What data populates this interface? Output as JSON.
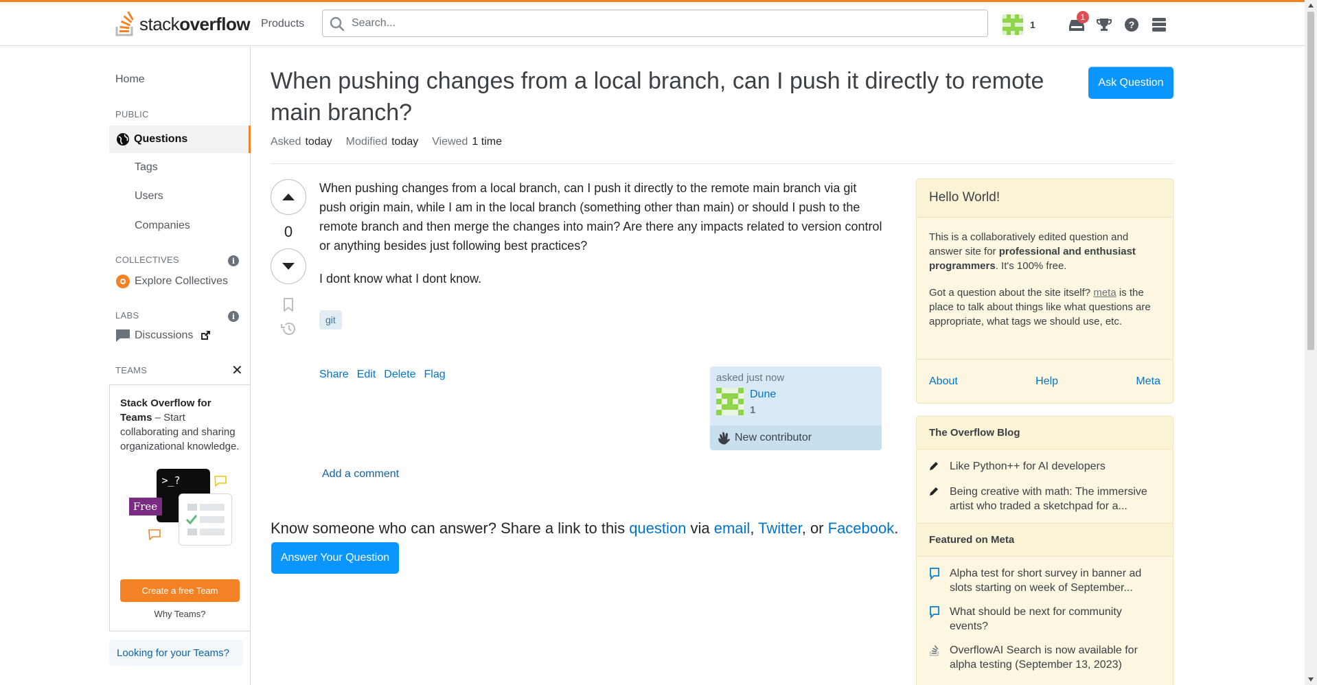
{
  "brand": {
    "logo_plain": "stack",
    "logo_bold": "overflow"
  },
  "topbar": {
    "products": "Products",
    "search_placeholder": "Search...",
    "reputation": "1",
    "inbox_badge": "1"
  },
  "sidebar": {
    "home": "Home",
    "public_label": "PUBLIC",
    "questions": "Questions",
    "tags": "Tags",
    "users": "Users",
    "companies": "Companies",
    "collectives_label": "COLLECTIVES",
    "explore_collectives": "Explore Collectives",
    "labs_label": "LABS",
    "discussions": "Discussions",
    "teams_label": "TEAMS",
    "teams_title": "Stack Overflow for Teams",
    "teams_desc": " – Start collaborating and sharing organizational knowledge.",
    "teams_free": "Free",
    "teams_prompt": ">_?",
    "create_team": "Create a free Team",
    "why_teams": "Why Teams?",
    "looking": "Looking for your Teams?"
  },
  "question": {
    "title": "When pushing changes from a local branch, can I push it directly to remote main branch?",
    "ask_button": "Ask Question",
    "asked_label": "Asked",
    "asked_value": "today",
    "modified_label": "Modified",
    "modified_value": "today",
    "viewed_label": "Viewed",
    "viewed_value": "1 time",
    "votes": "0",
    "body_p1": "When pushing changes from a local branch, can I push it directly to the remote main branch via git push origin main, while I am in the local branch (something other than main) or should I push to the remote branch and then merge the changes into main? Are there any impacts related to version control or anything besides just following best practices?",
    "body_p2": "I dont know what I dont know.",
    "tag": "git",
    "menu": {
      "share": "Share",
      "edit": "Edit",
      "delete": "Delete",
      "flag": "Flag"
    },
    "user": {
      "asked": "asked just now",
      "name": "Dune",
      "rep": "1",
      "new_contributor": "New contributor"
    },
    "add_comment": "Add a comment",
    "share_text_1": "Know someone who can answer? Share a link to this ",
    "share_question": "question",
    "share_via": " via ",
    "share_email": "email",
    "share_twitter": "Twitter",
    "share_or": ", or ",
    "share_facebook": "Facebook",
    "answer_button": "Answer Your Question"
  },
  "hello": {
    "title": "Hello World!",
    "p1_a": "This is a collaboratively edited question and answer site for ",
    "p1_b": "professional and enthusiast programmers",
    "p1_c": ". It's 100% free.",
    "p2_a": "Got a question about the site itself? ",
    "p2_link": "meta",
    "p2_b": " is the place to talk about things like what questions are appropriate, what tags we should use, etc.",
    "about": "About",
    "help": "Help",
    "meta": "Meta"
  },
  "blog": {
    "title": "The Overflow Blog",
    "items": [
      "Like Python++ for AI developers",
      "Being creative with math: The immersive artist who traded a sketchpad for a..."
    ],
    "featured_title": "Featured on Meta",
    "featured": [
      "Alpha test for short survey in banner ad slots starting on week of September...",
      "What should be next for community events?",
      "OverflowAI Search is now available for alpha testing (September 13, 2023)"
    ]
  },
  "colors": {
    "accent": "#f48225",
    "primary": "#0a95ff",
    "link": "#0074cc"
  }
}
